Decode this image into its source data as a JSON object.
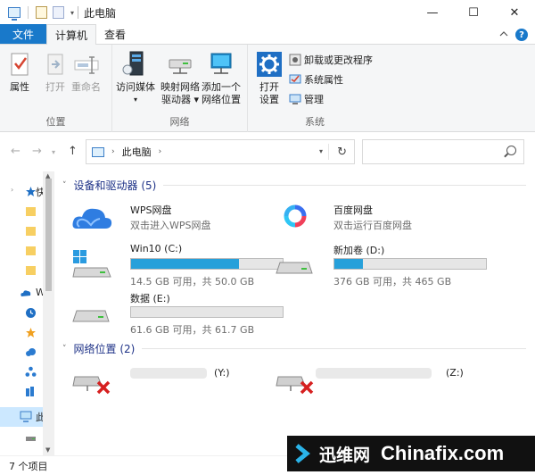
{
  "window": {
    "title": "此电脑",
    "minimize": "—",
    "maximize": "☐",
    "close": "✕",
    "quick_access_dropdown": "▾"
  },
  "ribbon_tabs": {
    "file": "文件",
    "computer": "计算机",
    "view": "查看",
    "collapse_icon": "chevron-up",
    "help": "?"
  },
  "ribbon": {
    "location": {
      "label": "位置",
      "properties": "属性",
      "open": "打开",
      "rename": "重命名"
    },
    "network": {
      "label": "网络",
      "access_media_l1": "访问媒体",
      "access_media_l2": "▾",
      "map_drive_l1": "映射网络",
      "map_drive_l2": "驱动器 ▾",
      "add_location_l1": "添加一个",
      "add_location_l2": "网络位置"
    },
    "system": {
      "label": "系统",
      "open_settings_l1": "打开",
      "open_settings_l2": "设置",
      "uninstall": "卸载或更改程序",
      "system_properties": "系统属性",
      "manage": "管理"
    }
  },
  "navbar": {
    "back": "←",
    "forward": "→",
    "recent_dropdown": "▾",
    "up": "↑",
    "crumb": "此电脑",
    "crumb_arrow": "›",
    "address_dropdown": "▾",
    "refresh": "↻"
  },
  "nav_pane": {
    "items": [
      {
        "label": "快",
        "icon": "star-icon",
        "expand": "›"
      },
      {
        "label": "",
        "icon": "folder-icon"
      },
      {
        "label": "",
        "icon": "folder-icon"
      },
      {
        "label": "",
        "icon": "folder-icon"
      },
      {
        "label": "",
        "icon": "folder-icon"
      },
      {
        "label": "W",
        "icon": "cloud-icon"
      },
      {
        "label": "",
        "icon": "clock-icon"
      },
      {
        "label": "",
        "icon": "star-icon"
      },
      {
        "label": "",
        "icon": "cloud-small-icon"
      },
      {
        "label": "",
        "icon": "share-icon"
      },
      {
        "label": "",
        "icon": "library-icon"
      },
      {
        "label": "此",
        "icon": "computer-icon",
        "selected": true
      },
      {
        "label": "",
        "icon": "drive-icon"
      }
    ]
  },
  "sections": {
    "devices": {
      "title": "设备和驱动器 (5)",
      "chevron": "˅"
    },
    "network": {
      "title": "网络位置 (2)",
      "chevron": "˅"
    }
  },
  "apps": [
    {
      "name": "WPS网盘",
      "sub": "双击进入WPS网盘",
      "icon": "wps-cloud-icon"
    },
    {
      "name": "百度网盘",
      "sub": "双击运行百度网盘",
      "icon": "baidu-netdisk-icon"
    }
  ],
  "drives": [
    {
      "name": "Win10 (C:)",
      "free": "14.5 GB 可用，共 50.0 GB",
      "used_fraction": 0.71,
      "icon": "windows-drive-icon"
    },
    {
      "name": "新加卷 (D:)",
      "free": "376 GB 可用，共 465 GB",
      "used_fraction": 0.19,
      "icon": "drive-icon"
    },
    {
      "name": "数据 (E:)",
      "free": "61.6 GB 可用，共 61.7 GB",
      "used_fraction": 0.0,
      "icon": "drive-icon"
    }
  ],
  "network_locations": [
    {
      "name": "(Y:)",
      "icon": "disconnected-network-drive-icon"
    },
    {
      "name": "(Z:)",
      "icon": "disconnected-network-drive-icon"
    }
  ],
  "status": {
    "count": "7 个项目"
  },
  "watermark": {
    "brand_cn": "迅维网",
    "brand_en": "Chinafix.com"
  },
  "colors": {
    "accent": "#1979ca",
    "bar_fill": "#26a0da",
    "selection": "#cce8ff"
  }
}
